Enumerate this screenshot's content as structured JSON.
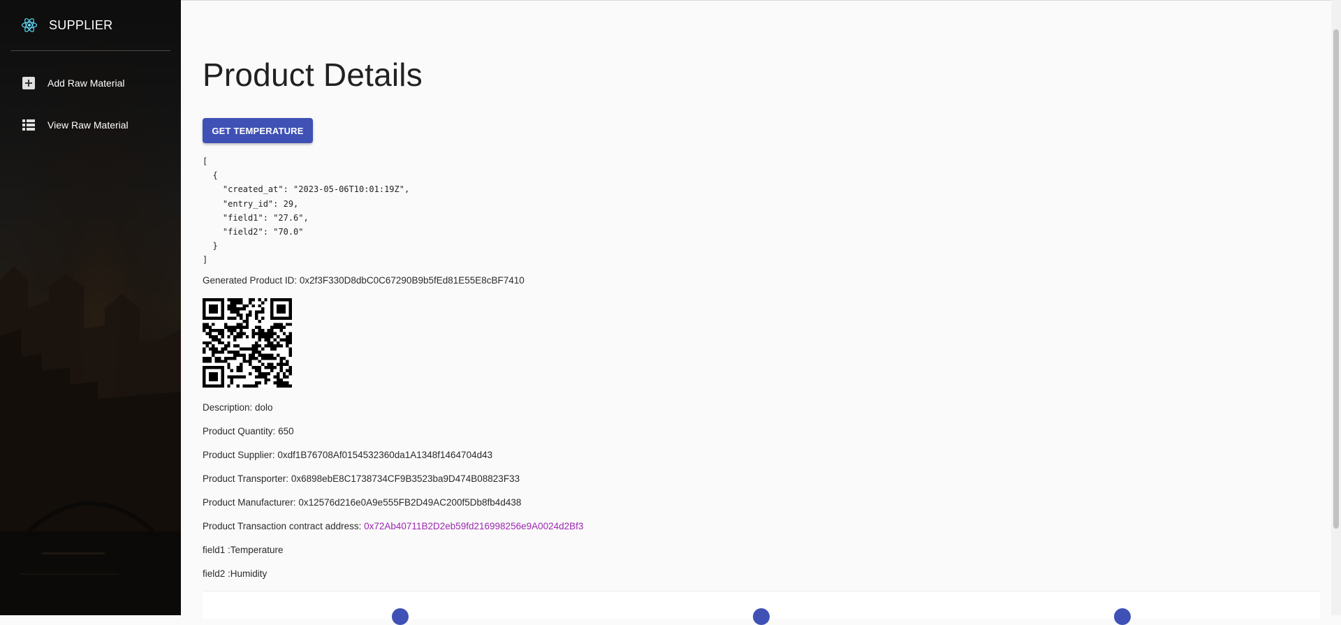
{
  "sidebar": {
    "brand": "SUPPLIER",
    "brand_icon": "react-atom-icon",
    "items": [
      {
        "label": "Add Raw Material",
        "icon": "add-box-icon"
      },
      {
        "label": "View Raw Material",
        "icon": "list-icon"
      }
    ]
  },
  "main": {
    "title": "Product Details",
    "get_temperature_label": "GET TEMPERATURE",
    "json_output": "[\n  {\n    \"created_at\": \"2023-05-06T10:01:19Z\",\n    \"entry_id\": 29,\n    \"field1\": \"27.6\",\n    \"field2\": \"70.0\"\n  }\n]",
    "product_id_label": "Generated Product ID: ",
    "product_id": "0x2f3F330D8dbC0C67290B9b5fEd81E55E8cBF7410",
    "description_label": "Description: ",
    "description": "dolo",
    "quantity_label": "Product Quantity: ",
    "quantity": "650",
    "supplier_label": "Product Supplier: ",
    "supplier": "0xdf1B76708Af0154532360da1A1348f1464704d43",
    "transporter_label": "Product Transporter: ",
    "transporter": "0x6898ebE8C1738734CF9B3523ba9D474B08823F33",
    "manufacturer_label": "Product Manufacturer: ",
    "manufacturer": "0x12576d216e0A9e555FB2D49AC200f5Db8fb4d438",
    "contract_label": "Product Transaction contract address: ",
    "contract_address": "0x72Ab40711B2D2eb59fd216998256e9A0024d2Bf3",
    "field1_label": "field1 :Temperature",
    "field2_label": "field2 :Humidity"
  },
  "colors": {
    "primary": "#3f51b5",
    "link": "#9c27b0",
    "sidebar_bg": "#2a2520"
  }
}
